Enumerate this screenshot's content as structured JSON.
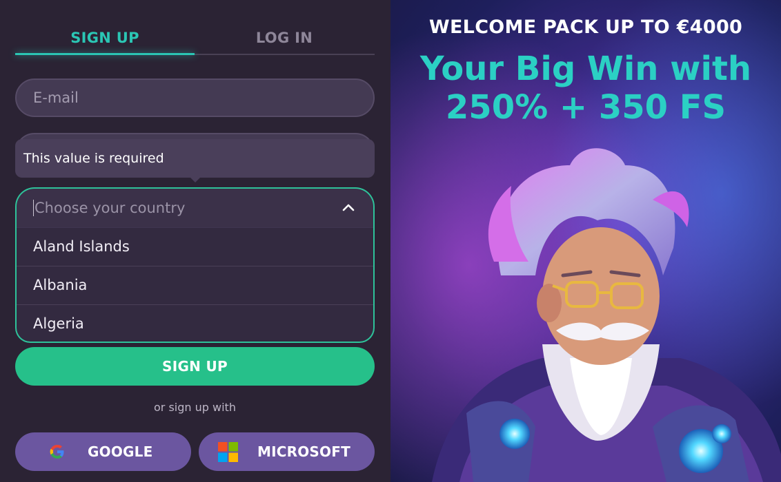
{
  "tabs": {
    "signup": "SIGN UP",
    "login": "LOG IN"
  },
  "form": {
    "email_placeholder": "E-mail",
    "validation_message": "This value is required",
    "country_placeholder": "Choose your country",
    "country_options": [
      "Aland Islands",
      "Albania",
      "Algeria"
    ],
    "signup_button": "SIGN UP",
    "or_text": "or sign up with",
    "social": {
      "google": "GOOGLE",
      "microsoft": "MICROSOFT"
    }
  },
  "promo": {
    "welcome": "WELCOME PACK UP TO €4000",
    "headline_line1": "Your Big Win with",
    "headline_line2": "250% + 350 FS"
  },
  "colors": {
    "accent": "#2bc6b4",
    "primary_button": "#26c08a",
    "social_button": "#6b56a0",
    "panel": "#2b2334"
  }
}
